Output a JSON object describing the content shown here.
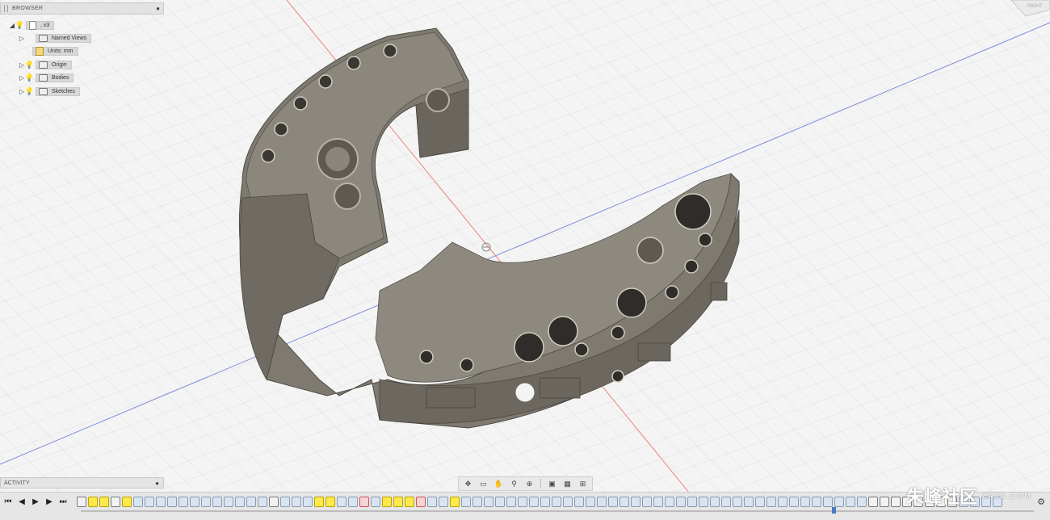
{
  "browser": {
    "title": "BROWSER",
    "collapse_icon": "collapse-icon",
    "items": [
      {
        "label": ", v3",
        "icon": "document-icon",
        "expanded": true
      },
      {
        "label": "Named Views",
        "icon": "folder-icon"
      },
      {
        "label": "Units: mm",
        "icon": "units-icon"
      },
      {
        "label": "Origin",
        "icon": "folder-icon"
      },
      {
        "label": "Bodies",
        "icon": "folder-icon"
      },
      {
        "label": "Sketches",
        "icon": "folder-icon"
      }
    ]
  },
  "activity": {
    "title": "ACTIVITY"
  },
  "viewcube": {
    "face_label": "RIGHT"
  },
  "nav_toolbar": [
    "orbit-icon",
    "look-at-icon",
    "pan-icon",
    "zoom-icon",
    "fit-icon",
    "display-settings-icon",
    "grid-settings-icon",
    "viewports-icon"
  ],
  "timeline": {
    "controls": [
      "go-to-start-icon",
      "step-back-icon",
      "play-icon",
      "step-forward-icon",
      "go-to-end-icon"
    ],
    "features": [
      "sk",
      "hl",
      "hl",
      "sk",
      "hl",
      "f",
      "f",
      "f",
      "f",
      "f",
      "f",
      "f",
      "f",
      "f",
      "f",
      "f",
      "f",
      "sk",
      "f",
      "f",
      "f",
      "hl",
      "hl",
      "f",
      "f",
      "x",
      "f",
      "hl",
      "hl",
      "hl",
      "x",
      "f",
      "f",
      "hl",
      "f",
      "f",
      "f",
      "f",
      "f",
      "f",
      "f",
      "f",
      "f",
      "f",
      "f",
      "f",
      "f",
      "f",
      "f",
      "f",
      "f",
      "f",
      "f",
      "f",
      "f",
      "f",
      "f",
      "f",
      "f",
      "f",
      "f",
      "f",
      "f",
      "f",
      "f",
      "f",
      "f",
      "f",
      "f",
      "f",
      "sk",
      "sk",
      "sk",
      "sk",
      "sk",
      "sk",
      "sk",
      "sk",
      "f",
      "f",
      "f",
      "f",
      "f",
      "f",
      "f",
      "f",
      "f",
      "f",
      "f",
      "f",
      "f",
      "f",
      "f",
      "f",
      "f",
      "f",
      "f",
      "f",
      "f",
      "f",
      "f",
      "f",
      "f",
      "x",
      "f",
      "f",
      "f",
      "f"
    ]
  },
  "watermark": {
    "brand": "朱峰社区",
    "site": "ZF3D.COM"
  },
  "colors": {
    "part": "#7f7a70",
    "part_light": "#a39f95",
    "part_dark": "#5e5a52",
    "grid": "#d4d4d4",
    "axis_x": "#e8867a",
    "axis_y": "#6e7fd8"
  }
}
